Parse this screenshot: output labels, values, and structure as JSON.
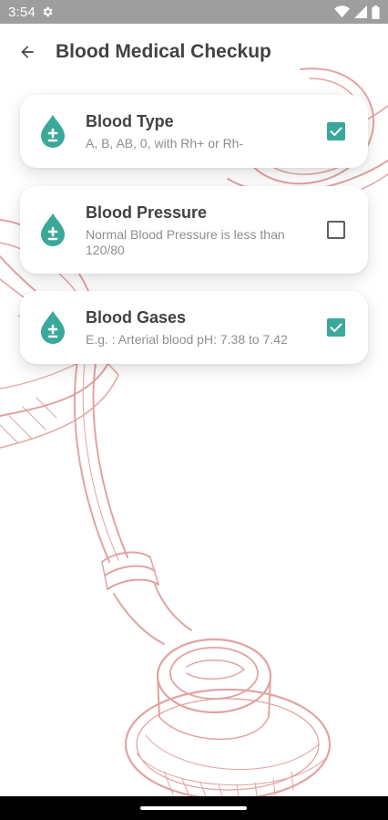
{
  "status_bar": {
    "time": "3:54",
    "icons": [
      "settings-gear-icon",
      "wifi-icon",
      "cell-signal-icon",
      "battery-icon"
    ]
  },
  "app_bar": {
    "back_icon": "arrow-back-icon",
    "title": "Blood Medical Checkup"
  },
  "items": [
    {
      "icon": "blood-drop-plus-minus-icon",
      "title": "Blood Type",
      "subtitle": "A, B, AB, 0, with Rh+ or Rh-",
      "checked": true
    },
    {
      "icon": "blood-drop-plus-minus-icon",
      "title": "Blood Pressure",
      "subtitle": "Normal Blood Pressure is less than 120/80",
      "checked": false
    },
    {
      "icon": "blood-drop-plus-minus-icon",
      "title": "Blood Gases",
      "subtitle": "E.g. : Arterial blood pH: 7.38 to 7.42",
      "checked": true
    }
  ],
  "background_image": "stethoscope-sketch",
  "colors": {
    "accent": "#3aa89a",
    "status_bar": "#9e9e9e",
    "title_text": "#424242",
    "subtitle_text": "#8e8e8e",
    "illustration": "#e2a3a3"
  }
}
